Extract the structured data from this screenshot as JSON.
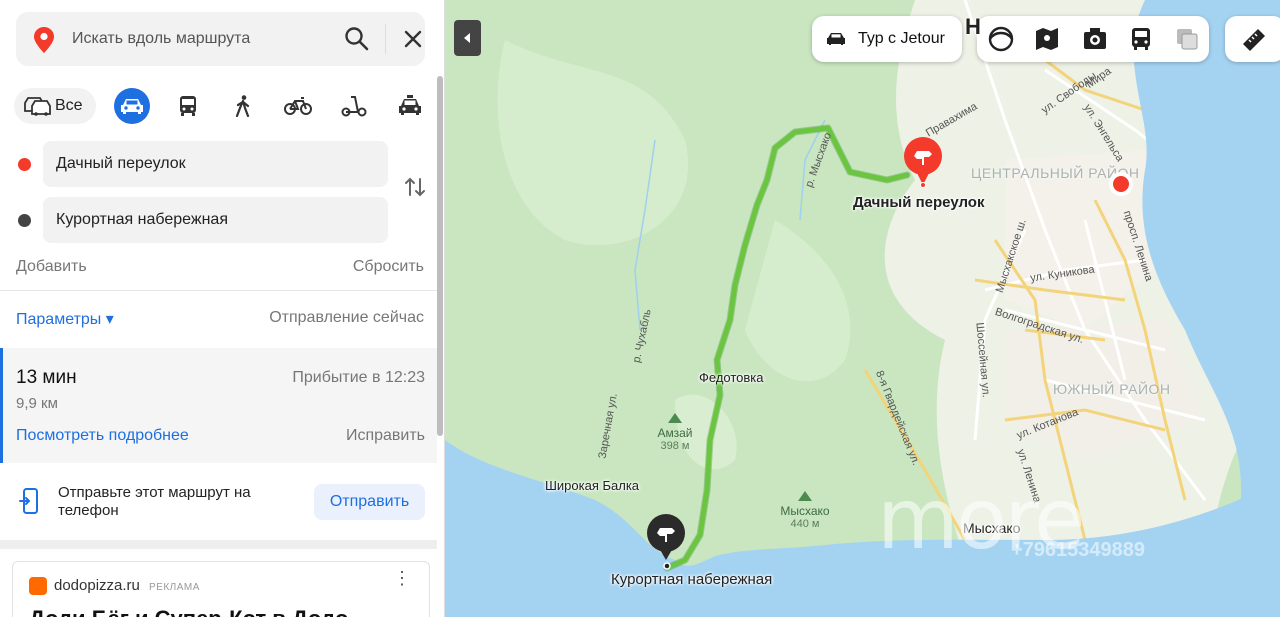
{
  "search": {
    "placeholder": "Искать вдоль маршрута"
  },
  "modes": {
    "all_label": "Все",
    "items": [
      "car",
      "bus",
      "walk",
      "bike",
      "scooter",
      "taxi"
    ],
    "active": "car"
  },
  "route_points": [
    {
      "label": "Дачный переулок",
      "color": "#f33a2b"
    },
    {
      "label": "Курортная набережная",
      "color": "#444444"
    }
  ],
  "actions": {
    "add": "Добавить",
    "reset": "Сбросить"
  },
  "params": {
    "label": "Параметры ▾",
    "departure": "Отправление сейчас"
  },
  "route": {
    "duration": "13 мин",
    "distance": "9,9 км",
    "arrival": "Прибытие в 12:23",
    "details": "Посмотреть подробнее",
    "fix": "Исправить"
  },
  "send": {
    "text": "Отправьте этот маршрут на телефон",
    "button": "Отправить"
  },
  "ad": {
    "site": "dodopizza.ru",
    "tag": "РЕКЛАМА",
    "title": "Доди Бёг и Супер-Кот в Додо"
  },
  "map": {
    "tour_label": "Тур с Jetour",
    "top_label": "Н",
    "places": {
      "start": "Дачный переулок",
      "end": "Курортная набережная",
      "fedotovka": "Федотовка",
      "shirokaya": "Широкая Балка",
      "myskhako": "Мысхако",
      "central": "ЦЕНТРАЛЬНЫЙ РАЙОН",
      "south": "ЮЖНЫЙ РАЙОН"
    },
    "peaks": [
      {
        "name": "Амзай",
        "elev": "398 м"
      },
      {
        "name": "Мысхако",
        "elev": "440 м"
      }
    ],
    "streets": {
      "svobody": "ул. Свободы",
      "mira": "Мира",
      "engels": "ул. Энгельса",
      "lenina_prosp": "просп. Ленина",
      "kunikova": "ул. Куникова",
      "volgogradskaya": "Волгоградская ул.",
      "kotanova": "ул. Котанова",
      "myskhakskoe": "Мысхакское ш.",
      "shosseynaya": "Шоссейная ул.",
      "gvardeyskaya": "8-я Гвардейская ул.",
      "lenina_street": "ул. Ленина",
      "zarechnaya": "Заречная ул.",
      "chukhabl": "р. Чухабль",
      "myskhako_river": "р. Мысхако",
      "pravahima": "Правахима"
    },
    "watermark": "more",
    "watermark_phone": "+79615349889",
    "colors": {
      "land": "#c9e6c0",
      "water": "#a4d3f2",
      "route": "#6bc541",
      "city": "#f3f1ea"
    }
  }
}
